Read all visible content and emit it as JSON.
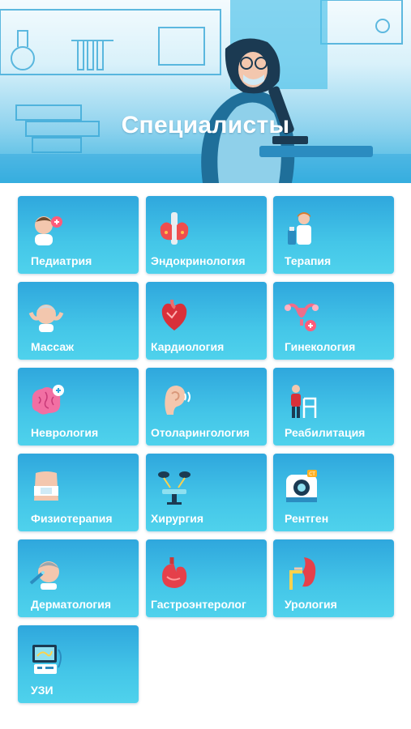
{
  "header": {
    "title": "Специалисты"
  },
  "specialties": [
    {
      "label": "Педиатрия",
      "icon": "baby-icon"
    },
    {
      "label": "Эндокринология",
      "icon": "thyroid-icon"
    },
    {
      "label": "Терапия",
      "icon": "therapist-icon"
    },
    {
      "label": "Массаж",
      "icon": "massage-icon"
    },
    {
      "label": "Кардиология",
      "icon": "heart-icon"
    },
    {
      "label": "Гинекология",
      "icon": "uterus-icon"
    },
    {
      "label": "Неврология",
      "icon": "brain-icon"
    },
    {
      "label": "Отоларингология",
      "icon": "ear-icon"
    },
    {
      "label": "Реабилитация",
      "icon": "walker-icon"
    },
    {
      "label": "Физиотерапия",
      "icon": "torso-icon"
    },
    {
      "label": "Хирургия",
      "icon": "surgery-lamp-icon"
    },
    {
      "label": "Рентген",
      "icon": "ct-scanner-icon"
    },
    {
      "label": "Дерматология",
      "icon": "face-treatment-icon"
    },
    {
      "label": "Гастроэнтеролог",
      "icon": "stomach-icon"
    },
    {
      "label": "Урология",
      "icon": "kidney-icon"
    },
    {
      "label": "УЗИ",
      "icon": "ultrasound-icon"
    }
  ],
  "colors": {
    "tile_top": "#2fa7dd",
    "tile_bottom": "#4fd2ec",
    "header_bottom": "#3cb4e0"
  }
}
